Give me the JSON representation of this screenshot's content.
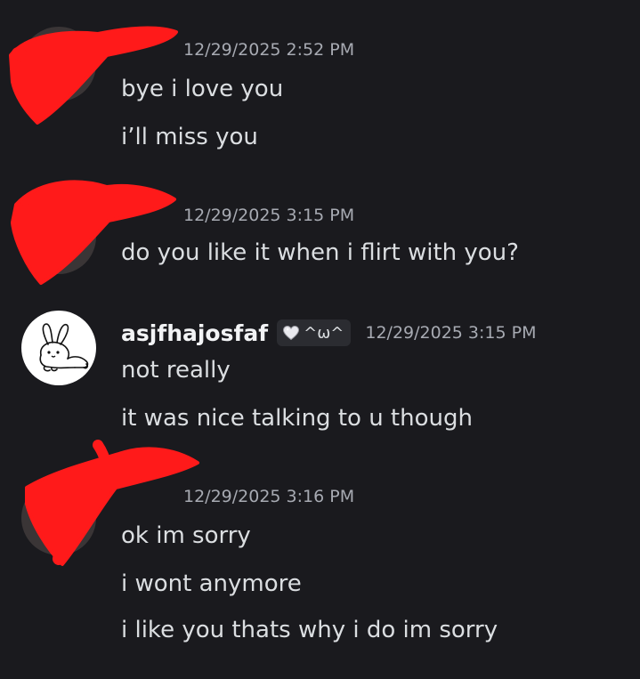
{
  "messages": [
    {
      "timestamp": "12/29/2025 2:52 PM",
      "lines": [
        "bye i love you",
        "i’ll miss you"
      ]
    },
    {
      "timestamp": "12/29/2025 3:15 PM",
      "lines": [
        "do you like it when i flirt with you?"
      ]
    },
    {
      "username": "asjfhajosfaf",
      "tag": "^ω^",
      "timestamp": "12/29/2025 3:15 PM",
      "lines": [
        "not really",
        "it was nice talking to u though"
      ]
    },
    {
      "timestamp": "12/29/2025 3:16 PM",
      "lines": [
        "ok im sorry",
        "i wont anymore",
        "i like you thats why i do im sorry"
      ]
    }
  ],
  "colors": {
    "background": "#1a1a1e",
    "text": "#dbdee1",
    "timestamp": "#a7aab2",
    "redaction": "#ff1a1a"
  },
  "icons": {
    "tag_badge": "heart-icon",
    "bunny_avatar": "bunny-avatar"
  }
}
